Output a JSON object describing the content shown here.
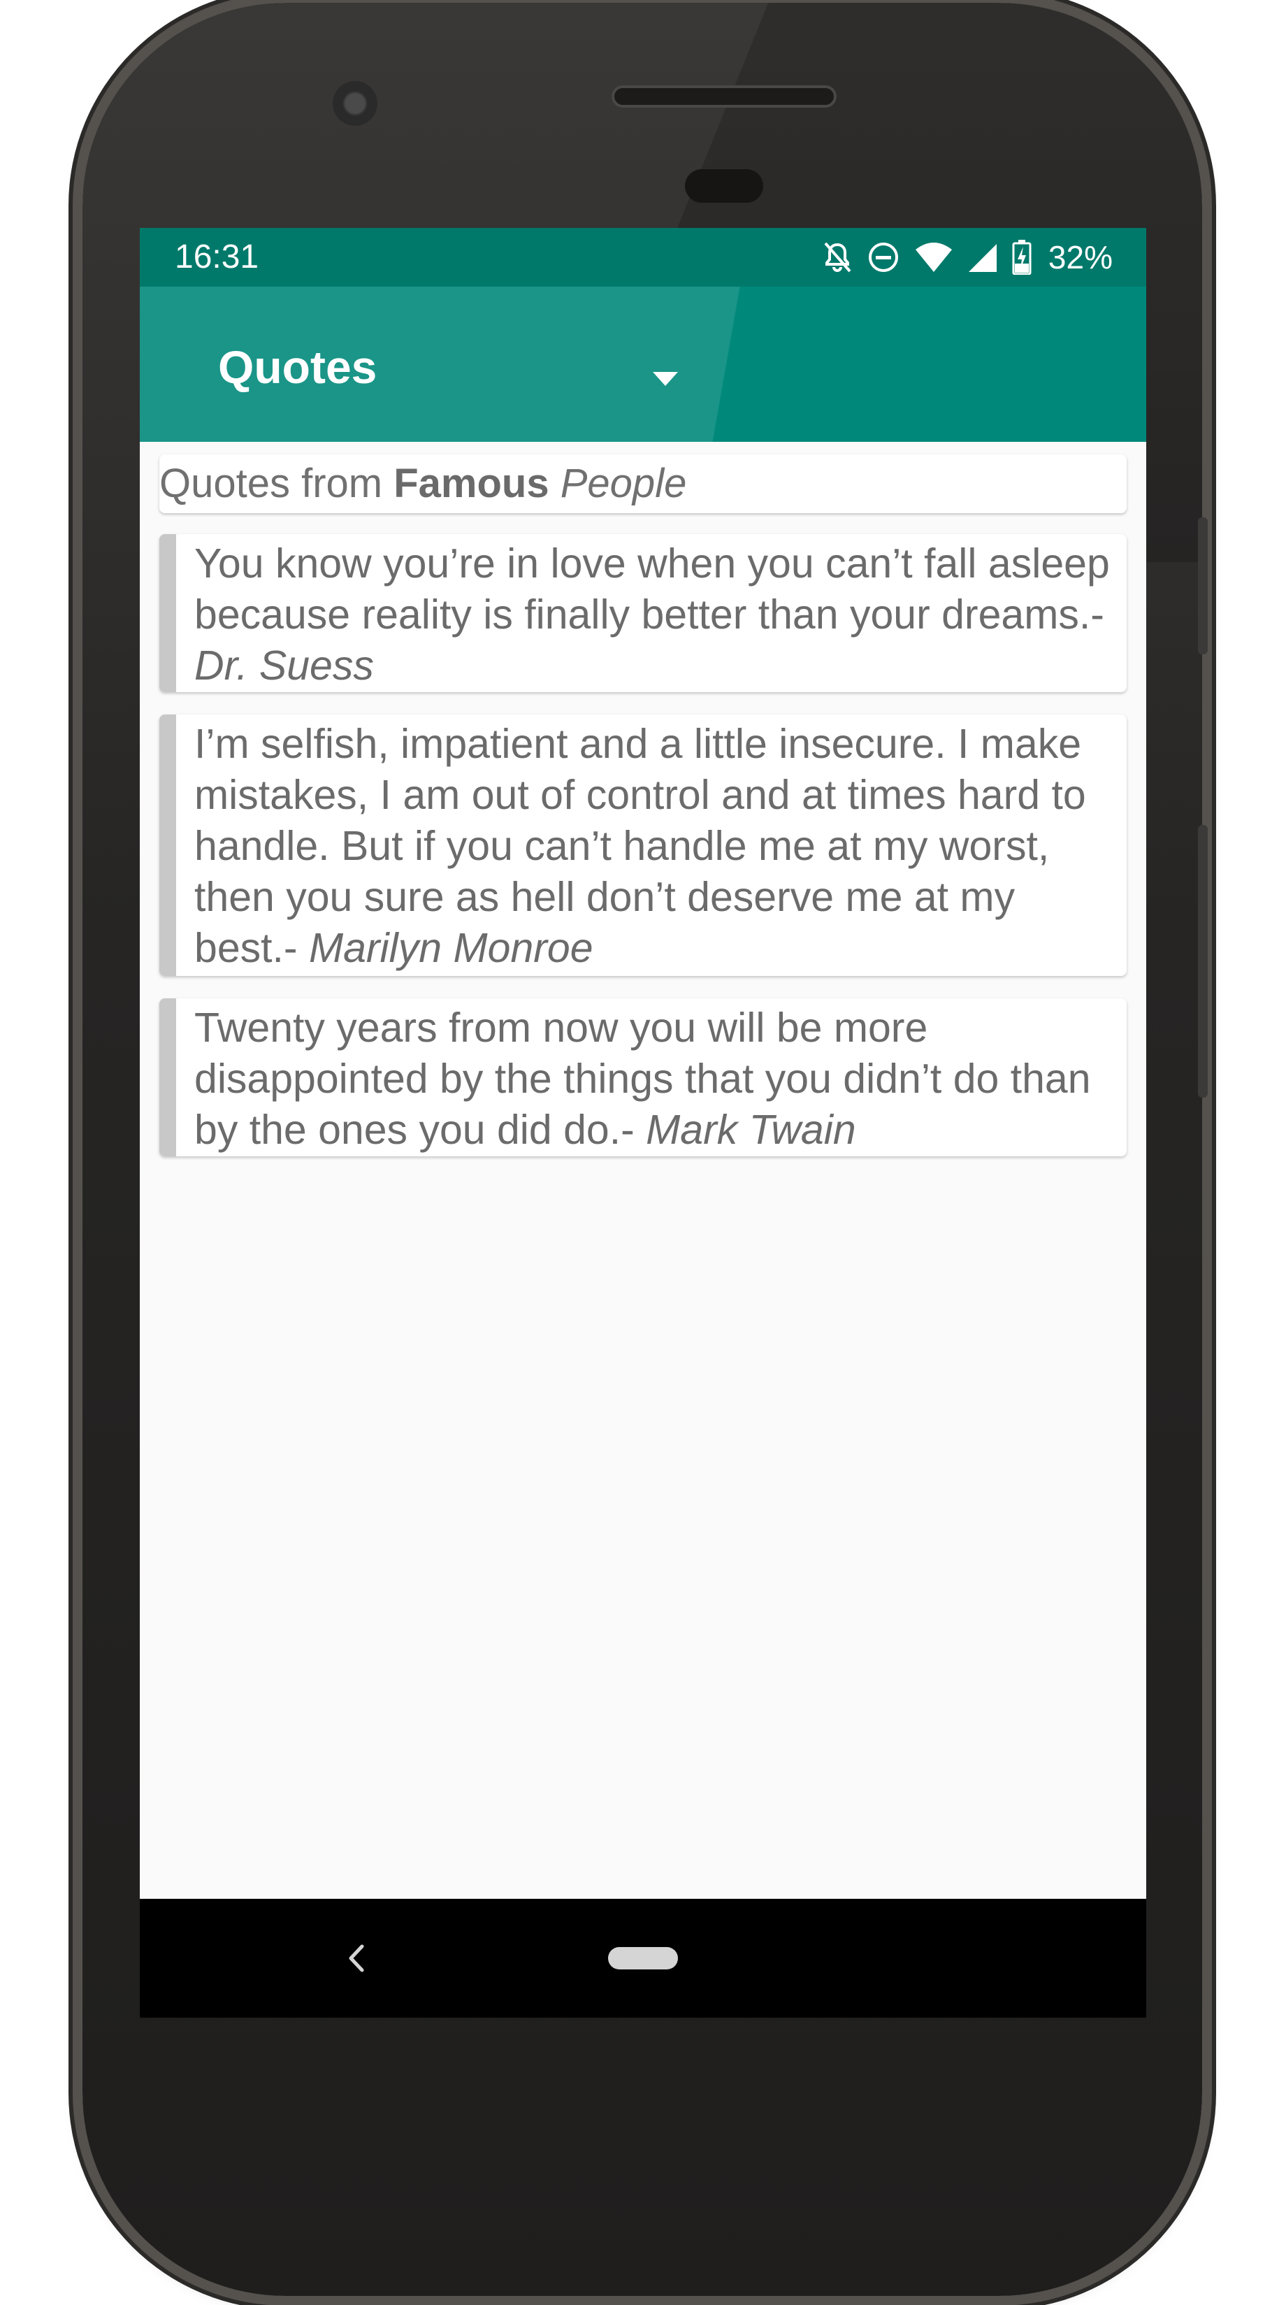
{
  "status_bar": {
    "time": "16:31",
    "battery": "32%",
    "icons": [
      "notifications-off-icon",
      "do-not-disturb-icon",
      "wifi-icon",
      "cell-signal-icon",
      "battery-charging-icon"
    ]
  },
  "toolbar": {
    "spinner_label": "Quotes",
    "spinner_icon": "dropdown-arrow-icon",
    "color": "#00897b"
  },
  "header": {
    "prefix": "Quotes from ",
    "bold": "Famous",
    "space": " ",
    "italic": "People"
  },
  "quotes": [
    {
      "text": "You know you’re in love when you can’t fall asleep because reality is finally better than your dreams.- ",
      "author": "Dr. Suess"
    },
    {
      "text": "I’m selfish, impatient and a little insecure. I make mistakes, I am out of control and at times hard to handle. But if you can’t handle me at my worst, then you sure as hell don’t deserve me at my best.- ",
      "author": "Marilyn Monroe"
    },
    {
      "text": "Twenty years from now you will be more disappointed by the things that you didn’t do than by the ones you did do.- ",
      "author": "Mark Twain"
    }
  ],
  "nav_bar": {
    "back_icon": "back-chevron-icon",
    "home_icon": "home-pill-icon"
  },
  "colors": {
    "status_bar": "#00796b",
    "toolbar": "#00897b",
    "card_accent": "#c8c8c8",
    "text": "#6b6b6b"
  }
}
